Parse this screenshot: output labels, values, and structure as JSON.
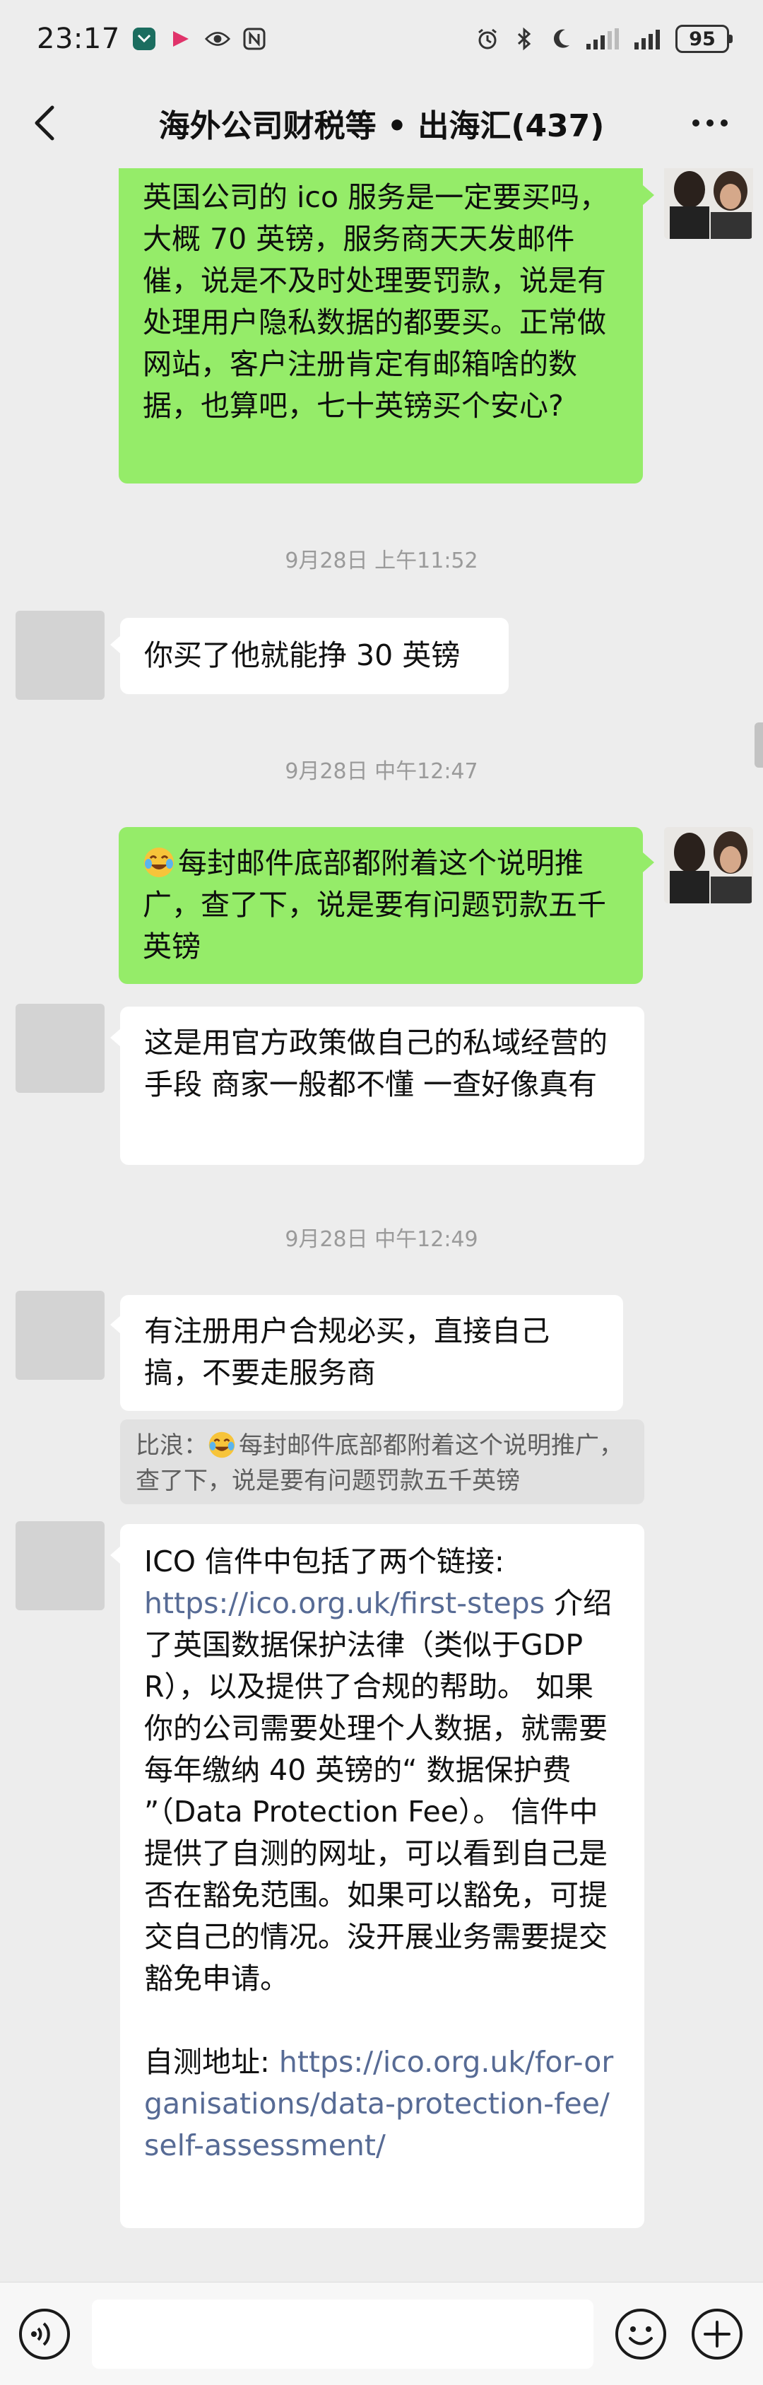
{
  "status_bar": {
    "time": "23:17",
    "battery": "95",
    "left_icons": [
      "app-notification-icon",
      "flag-icon",
      "eye-icon",
      "nfc-icon"
    ],
    "right_icons": [
      "alarm-icon",
      "bluetooth-icon",
      "moon-icon",
      "signal-icon",
      "signal-icon",
      "battery-icon"
    ]
  },
  "nav": {
    "title": "海外公司财税等 • 出海汇(437)"
  },
  "messages": {
    "m1": {
      "text": "英国公司的 ico 服务是一定要买吗，大概 70 英镑，服务商天天发邮件催，说是不及时处理要罚款，说是有处理用户隐私数据的都要买。正常做网站，客户注册肯定有邮箱啥的数据，也算吧，七十英镑买个安心?"
    },
    "t1": "9月28日 上午11:52",
    "m2": {
      "text": "你买了他就能挣 30 英镑"
    },
    "t2": "9月28日 中午12:47",
    "m3": {
      "text": "每封邮件底部都附着这个说明推广，查了下，说是要有问题罚款五千英镑"
    },
    "m4": {
      "text": "这是用官方政策做自己的私域经营的手段  商家一般都不懂  一查好像真有"
    },
    "t3": "9月28日 中午12:49",
    "m5": {
      "text": "有注册用户合规必买，直接自己搞，不要走服务商",
      "quote_author": "比浪：",
      "quote_text": "每封邮件底部都附着这个说明推广，查了下，说是要有问题罚款五千英镑"
    },
    "m6": {
      "p1_start": "ICO 信件中包括了两个链接:",
      "link1": "https://ico.org.uk/first-steps",
      "p1_rest": " 介绍了英国数据保护法律（类似于GDPR），以及提供了合规的帮助。 如果你的公司需要处理个人数据，就需要每年缴纳 40 英镑的“ 数据保护费 ”（Data Protection Fee）。 信件中提供了自测的网址，可以看到自己是否在豁免范围。如果可以豁免，可提交自己的情况。没开展业务需要提交豁免申请。",
      "p2_label": "自测地址: ",
      "link2": "https://ico.org.uk/for-organisations/data-protection-fee/self-assessment/"
    }
  },
  "input_bar": {
    "placeholder": ""
  },
  "colors": {
    "background": "#ededed",
    "green_bubble": "#95ec69",
    "white_bubble": "#ffffff",
    "link": "#576b95",
    "timestamp": "#9a9a9a"
  }
}
